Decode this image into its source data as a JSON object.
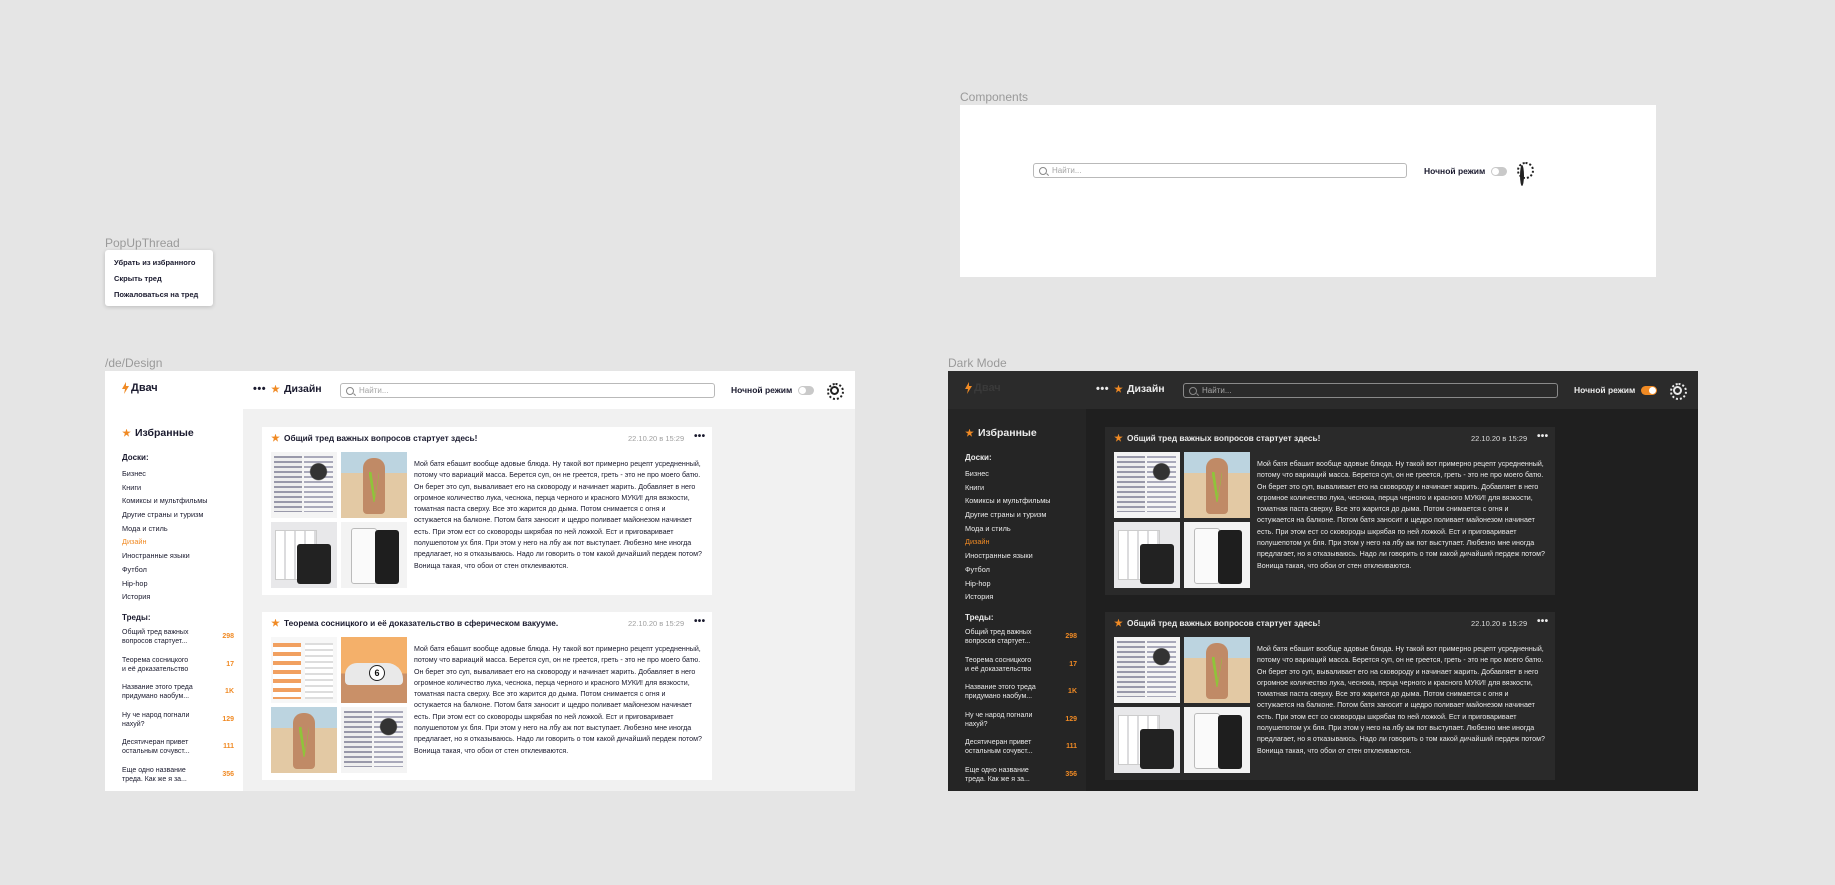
{
  "labels": {
    "popup_frame": "PopUpThread",
    "components_frame": "Components",
    "light_frame": "/de/Design",
    "dark_frame": "Dark Mode"
  },
  "popup": {
    "items": [
      "Убрать из избранного",
      "Скрыть тред",
      "Пожаловаться на тред"
    ]
  },
  "header": {
    "logo": "Двач",
    "more": "•••",
    "board": "Дизайн",
    "search_placeholder": "Найти...",
    "night_mode": "Ночной режим"
  },
  "sidebar": {
    "favorites": "Избранные",
    "boards_title": "Доски:",
    "boards": [
      "Бизнес",
      "Книги",
      "Комиксы и мультфильмы",
      "Другие страны и туризм",
      "Мода и стиль",
      "Дизайн",
      "Иностранные языки",
      "Футбол",
      "Hip-hop",
      "История"
    ],
    "active_board_index": 5,
    "threads_title": "Треды:",
    "threads_light": [
      {
        "name": "Общий тред важных вопросов стартует...",
        "count": "298"
      },
      {
        "name": "Теорема сосницкого и её доказательство в...",
        "count": "17"
      },
      {
        "name": "Название этого треда придумано наобум...",
        "count": "1K"
      },
      {
        "name": "Ну че народ погнали нахуй?",
        "count": "129"
      },
      {
        "name": "Десятичеран привет остальным сочувст...",
        "count": "111"
      },
      {
        "name": "Еще одно название треда. Как же я за...",
        "count": "356"
      }
    ],
    "threads_dark": [
      {
        "name": "Общий тред важных вопросов стартует...",
        "count": "298"
      },
      {
        "name": "Теорема сосницкого и её доказательство в...",
        "count": "17"
      },
      {
        "name": "Название этого треда придумано наобум...",
        "count": "1K"
      },
      {
        "name": "Ну че народ погнали нахуй?",
        "count": "129"
      },
      {
        "name": "Десятичеран привет остальным сочувст...",
        "count": "111"
      },
      {
        "name": "Еще одно название треда. Как же я за...",
        "count": "356"
      }
    ]
  },
  "posts": {
    "light": [
      {
        "title": "Общий тред важных вопросов стартует здесь!",
        "date": "22.10.20 в 15:29"
      },
      {
        "title": "Теорема сосницкого и её доказательство в сферическом вакууме.",
        "date": "22.10.20 в 15:29"
      }
    ],
    "dark": [
      {
        "title": "Общий тред важных вопросов стартует здесь!",
        "date": "22.10.20 в 15:29"
      },
      {
        "title": "Общий тред важных вопросов стартует здесь!",
        "date": "22.10.20 в 15:29"
      }
    ],
    "more": "•••",
    "body": "Мой батя ебашит вообще адовые блюда. Ну такой вот примерно рецепт усредненный, потому что вариаций масса. Берется суп, он не греется, греть - это не про моего батю. Он берет это суп, вываливает его на сковороду и начинает жарить. Добавляет в него огромное количество лука, чеснока, перца черного и красного МУКИ! для вязкости, томатная паста сверху. Все это жарится до дыма. Потом снимается с огня и остужается на балконе. Потом батя заносит и щедро поливает майонезом начинает есть. При этом ест со сковороды шкрябая по ней ложкой. Ест и приговаривает полушепотом ух бля. При этом у него на лбу аж пот выступает. Любезно мне иногда предлагает, но я отказываюсь. Надо ли говорить о том какой дичайший пердеж потом? Вонища такая, что обои от стен отклеиваются."
  },
  "colors": {
    "accent": "#f08a24",
    "light_bg": "#f1f1f1",
    "dark_bg": "#1f1f1f"
  }
}
